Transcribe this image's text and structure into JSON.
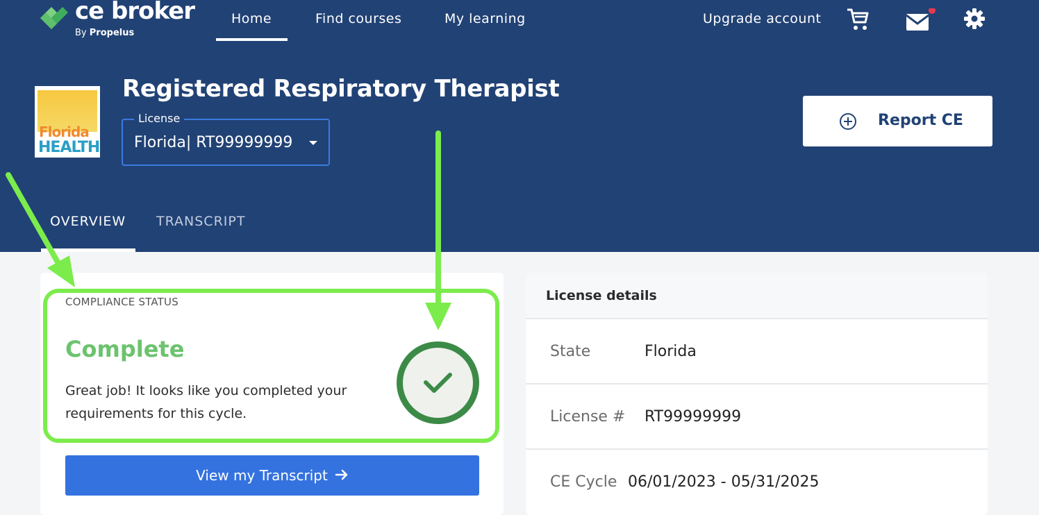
{
  "brand": {
    "name": "ce broker",
    "by_prefix": "By",
    "by_company": "Propelus"
  },
  "nav": {
    "items": [
      {
        "label": "Home",
        "active": true
      },
      {
        "label": "Find courses"
      },
      {
        "label": "My learning"
      }
    ],
    "upgrade_label": "Upgrade account",
    "icons": [
      "cart-icon",
      "mail-icon",
      "gear-icon"
    ],
    "notification_dot_color": "#e8384f"
  },
  "board_logo": {
    "line1": "Florida",
    "line2": "HEALTH"
  },
  "license_header": {
    "title": "Registered Respiratory Therapist",
    "select_legend": "License",
    "select_value": "Florida| RT99999999",
    "report_button_label": "Report CE"
  },
  "tabs": [
    {
      "label": "OVERVIEW",
      "active": true
    },
    {
      "label": "TRANSCRIPT"
    }
  ],
  "compliance": {
    "section_label": "COMPLIANCE STATUS",
    "status": "Complete",
    "message": "Great job! It looks like you completed your requirements for this cycle.",
    "button_label": "View my Transcript",
    "status_color": "#6cc36e",
    "highlight_color": "#7bec4c"
  },
  "license_details": {
    "title": "License details",
    "rows": [
      {
        "label": "State",
        "value": "Florida"
      },
      {
        "label": "License #",
        "value": "RT99999999"
      },
      {
        "label": "CE Cycle",
        "value": "06/01/2023 - 05/31/2025"
      }
    ]
  },
  "colors": {
    "header_bg": "#214275",
    "primary_button": "#3472df",
    "annotation_arrow": "#7bec4c"
  }
}
